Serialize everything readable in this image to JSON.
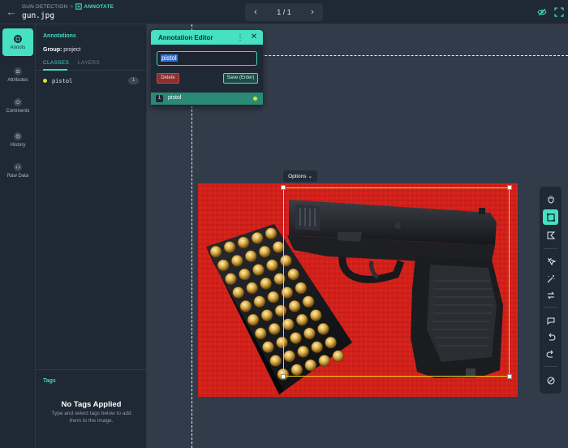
{
  "header": {
    "breadcrumb_project": "GUN DETECTION",
    "breadcrumb_separator": ">",
    "breadcrumb_current": "ANNOTATE",
    "filename": "gun.jpg",
    "pager": "1 / 1"
  },
  "rail": {
    "items": [
      {
        "label": "Annots",
        "icon": "annotations-icon",
        "active": true
      },
      {
        "label": "Attributes",
        "icon": "attributes-icon"
      },
      {
        "label": "Comments",
        "icon": "comments-icon"
      },
      {
        "label": "History",
        "icon": "history-icon"
      },
      {
        "label": "Raw Data",
        "icon": "raw-data-icon"
      }
    ]
  },
  "panel": {
    "title": "Annotations",
    "group_label": "Group:",
    "group_value": "project",
    "tabs": [
      {
        "label": "CLASSES",
        "active": true
      },
      {
        "label": "LAYERS"
      }
    ],
    "classes": [
      {
        "name": "pistol",
        "count": "1",
        "color": "#d7e52a"
      }
    ],
    "tags_title": "Tags",
    "tags_empty": "No Tags Applied",
    "tags_hint": "Type and select tags below to add them to the image."
  },
  "editor": {
    "title": "Annotation Editor",
    "input_value": "pistol",
    "delete_label": "Delete",
    "save_label": "Save (Enter)",
    "row_index": "1",
    "row_label": "pistol"
  },
  "canvas": {
    "options_label": "Options",
    "bbox_color": "#f0d51c",
    "accent": "#46e0c3"
  },
  "toolbar": {
    "tools": [
      "hand-icon",
      "bounding-box-icon",
      "polygon-icon",
      "smart-select-icon",
      "magic-wand-icon",
      "swap-icon",
      "comment-icon",
      "undo-icon",
      "redo-icon",
      "no-entry-icon"
    ],
    "active_tool": "bounding-box-icon"
  }
}
